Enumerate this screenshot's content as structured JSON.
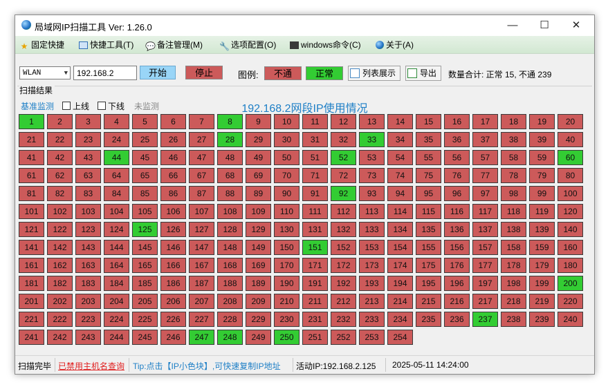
{
  "colors": {
    "up": "#33cc33",
    "down": "#cc5a5a",
    "accent": "#1e7fc6",
    "link_red": "#e02020"
  },
  "window": {
    "title": "局域网IP扫描工具  Ver: 1.26.0",
    "icon": "globe-icon",
    "minimize": "—",
    "maximize": "☐",
    "close": "✕"
  },
  "menu": [
    {
      "label": "固定快捷",
      "icon": "star-icon"
    },
    {
      "label": "快捷工具(T)",
      "icon": "monitor-icon"
    },
    {
      "label": "备注管理(M)",
      "icon": "speech-bubble-icon"
    },
    {
      "label": "选项配置(O)",
      "icon": "wrench-icon"
    },
    {
      "label": "windows命令(C)",
      "icon": "console-icon"
    },
    {
      "label": "关于(A)",
      "icon": "globe-icon"
    }
  ],
  "toolbar": {
    "adapter": "WLAN",
    "ip_prefix": "192.168.2",
    "start_label": "开始",
    "stop_label": "停止",
    "legend_label": "图例:",
    "legend_down": "不通",
    "legend_up": "正常",
    "list_label": "列表展示",
    "export_label": "导出",
    "count_text": "数量合计: 正常 15, 不通 239"
  },
  "results": {
    "group_title": "扫描结果",
    "baseline_label": "基准监测",
    "online_label": "上线",
    "offline_label": "下线",
    "unmonitored_label": "未监测",
    "grid_title": "192.168.2网段IP使用情况",
    "total": 254,
    "up_hosts": [
      1,
      8,
      28,
      33,
      44,
      52,
      60,
      92,
      125,
      151,
      200,
      237,
      247,
      248,
      250
    ]
  },
  "status": {
    "state": "扫描完毕",
    "hostname_notice": "已禁用主机名查询",
    "tip": "Tip:点击【IP小色块】,可快速复制IP地址",
    "active_ip": "活动IP:192.168.2.125",
    "datetime": "2025-05-11 14:24:00"
  }
}
